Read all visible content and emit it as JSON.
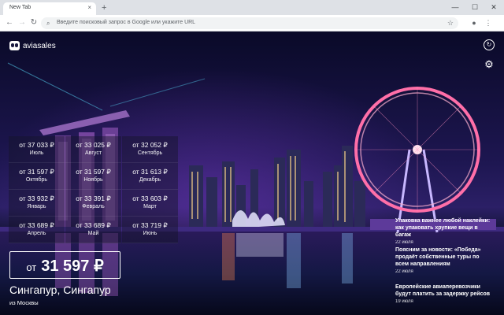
{
  "browser": {
    "tab_title": "New Tab",
    "tab_close": "×",
    "new_tab": "+",
    "omnibox_placeholder": "Введите поисковый запрос в Google или укажите URL",
    "win_min": "—",
    "win_max": "☐",
    "win_close": "✕"
  },
  "brand": {
    "name": "aviasales"
  },
  "prices": [
    {
      "price": "от 37 033 ₽",
      "month": "Июль"
    },
    {
      "price": "от 33 025 ₽",
      "month": "Август"
    },
    {
      "price": "от 32 052 ₽",
      "month": "Сентябрь"
    },
    {
      "price": "от 31 597 ₽",
      "month": "Октябрь"
    },
    {
      "price": "от 31 597 ₽",
      "month": "Ноябрь"
    },
    {
      "price": "от 31 613 ₽",
      "month": "Декабрь"
    },
    {
      "price": "от 33 932 ₽",
      "month": "Январь"
    },
    {
      "price": "от 33 391 ₽",
      "month": "Февраль"
    },
    {
      "price": "от 33 603 ₽",
      "month": "Март"
    },
    {
      "price": "от 33 689 ₽",
      "month": "Апрель"
    },
    {
      "price": "от 33 689 ₽",
      "month": "Май"
    },
    {
      "price": "от 33 719 ₽",
      "month": "Июнь"
    }
  ],
  "best": {
    "prefix": "от",
    "price": "31 597 ₽"
  },
  "destination": "Сингапур, Сингапур",
  "origin": "из Москвы",
  "news": [
    {
      "title": "Упаковка важнее любой наклейки: как упаковать хрупкие вещи в багаж",
      "date": "22 июля"
    },
    {
      "title": "Поясним за новости: «Победа» продаёт собственные туры по всем направлениям",
      "date": "22 июля"
    },
    {
      "title": "Европейские авиаперевозчики будут платить за задержку рейсов",
      "date": "19 июля"
    }
  ],
  "icons": {
    "back": "arrow-left-icon",
    "forward": "arrow-right-icon",
    "reload": "reload-icon",
    "search": "search-icon",
    "star": "star-icon",
    "profile": "profile-icon",
    "menu": "more-vert-icon",
    "refresh_bg": "refresh-background-icon",
    "settings": "gear-icon"
  }
}
